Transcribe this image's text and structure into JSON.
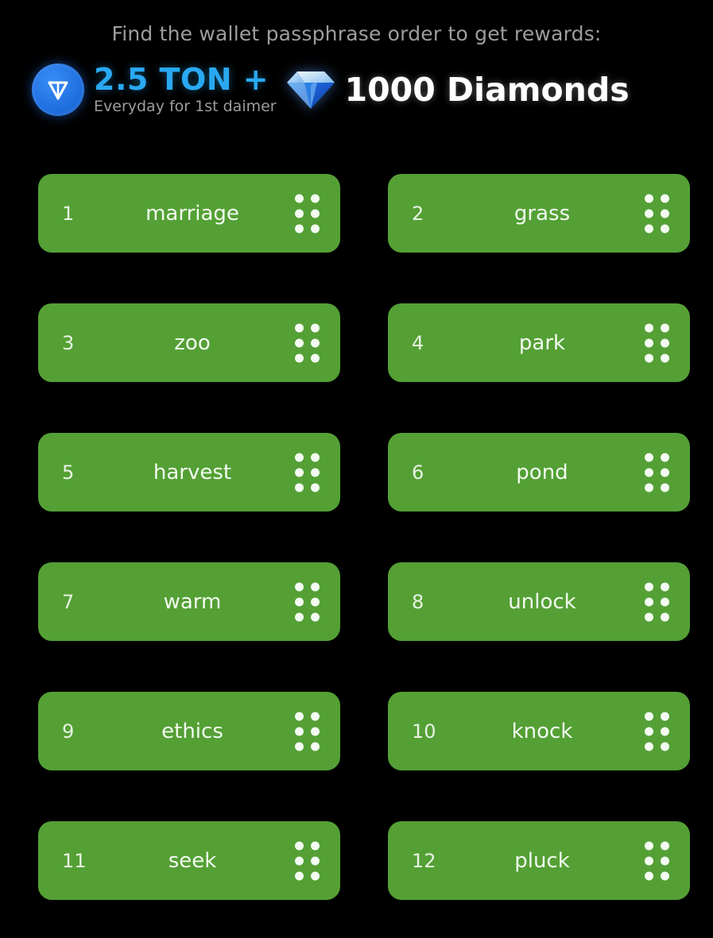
{
  "header": {
    "title": "Find the wallet passphrase order to get rewards:",
    "title_color": "#9d9d9d",
    "rewards": [
      {
        "icon": "ton-coin-icon",
        "amount": "2.5 TON +",
        "sub": "Everyday for 1st daimer",
        "color": "#29a9f2"
      },
      {
        "icon": "diamond-gem-icon",
        "amount": "1000 Diamonds",
        "color": "#ffffff"
      }
    ]
  },
  "grid": {
    "card_color": "#54a035",
    "handle_icon": "drag-handle-dots-icon",
    "words": [
      {
        "index": "1",
        "word": "marriage"
      },
      {
        "index": "2",
        "word": "grass"
      },
      {
        "index": "3",
        "word": "zoo"
      },
      {
        "index": "4",
        "word": "park"
      },
      {
        "index": "5",
        "word": "harvest"
      },
      {
        "index": "6",
        "word": "pond"
      },
      {
        "index": "7",
        "word": "warm"
      },
      {
        "index": "8",
        "word": "unlock"
      },
      {
        "index": "9",
        "word": "ethics"
      },
      {
        "index": "10",
        "word": "knock"
      },
      {
        "index": "11",
        "word": "seek"
      },
      {
        "index": "12",
        "word": "pluck"
      }
    ]
  }
}
